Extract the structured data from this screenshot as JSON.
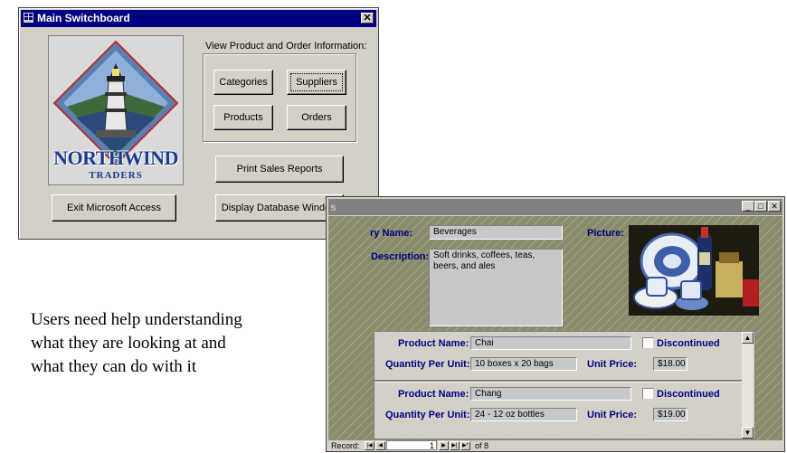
{
  "switchboard": {
    "title": "Main Switchboard",
    "logo_text": "NORTHWIND",
    "logo_subtext": "TRADERS",
    "group_label": "View Product and Order Information:",
    "buttons": {
      "categories": "Categories",
      "suppliers": "Suppliers",
      "products": "Products",
      "orders": "Orders",
      "print_sales_reports": "Print Sales Reports",
      "exit_access": "Exit Microsoft Access",
      "display_db_window": "Display Database Window"
    }
  },
  "categories_form": {
    "title_fragment": "s",
    "category_name_label": "ry Name:",
    "category_name_value": "Beverages",
    "description_label": "Description:",
    "description_value": "Soft drinks, coffees, teas, beers, and ales",
    "picture_label": "Picture:",
    "products": [
      {
        "product_name_label": "Product Name:",
        "product_name": "Chai",
        "discontinued_label": "Discontinued",
        "quantity_label": "Quantity Per Unit:",
        "quantity": "10 boxes x 20 bags",
        "unit_price_label": "Unit Price:",
        "unit_price": "$18.00"
      },
      {
        "product_name_label": "Product Name:",
        "product_name": "Chang",
        "discontinued_label": "Discontinued",
        "quantity_label": "Quantity Per Unit:",
        "quantity": "24 - 12 oz bottles",
        "unit_price_label": "Unit Price:",
        "unit_price": "$19.00"
      }
    ],
    "record_nav": {
      "label": "Record:",
      "current": "1",
      "of_text": "of 8"
    }
  },
  "caption": {
    "line1": "Users need help understanding",
    "line2": "what they are looking at and",
    "line3": "what they can do with it"
  }
}
